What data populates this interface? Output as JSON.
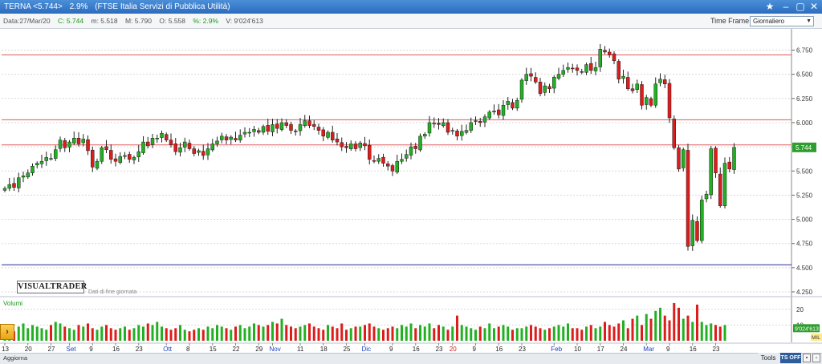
{
  "window": {
    "symbol": "TERNA <5.744>",
    "change": "2.9%",
    "description": "(FTSE Italia Servizi di Pubblica Utilità)",
    "buttons": [
      "star-icon",
      "minimize-icon",
      "restore-icon",
      "close-icon"
    ]
  },
  "infobar": {
    "date": "Data:27/Mar/20",
    "close": "C: 5.744",
    "min": "m: 5.518",
    "max": "M: 5.790",
    "open": "O: 5.558",
    "pct": "%: 2.9%",
    "volume": "V: 9'024'613"
  },
  "time_frame": {
    "label": "Time Frame",
    "selected": "Giornaliero"
  },
  "logo": "VISUALTRADER",
  "eod_note": "Dati di fine giornata",
  "volumes_label": "Volumi",
  "status": {
    "update_label": "Aggiorna",
    "tools_label": "Tools",
    "ts_label": "TS OFF"
  },
  "colors": {
    "up": "#22b022",
    "down": "#dd1c1c",
    "hline_red": "#e05a5a",
    "hline_blue": "#2a2a9a",
    "price_tag": "#2e9e2e"
  },
  "chart_data": [
    {
      "type": "candlestick",
      "last_price": "5.744",
      "y_ticks": [
        "6.750",
        "6.500",
        "6.250",
        "6.000",
        "5.750",
        "5.500",
        "5.250",
        "5.000",
        "4.750",
        "4.500",
        "4.250"
      ],
      "ylim": [
        4.25,
        6.92
      ],
      "horizontal_lines": [
        {
          "value": 6.7,
          "color": "red"
        },
        {
          "value": 6.03,
          "color": "red"
        },
        {
          "value": 5.77,
          "color": "red"
        },
        {
          "value": 4.53,
          "color": "blue"
        }
      ],
      "x_ticks": [
        {
          "label": "13",
          "index": 0,
          "month": false
        },
        {
          "label": "20",
          "index": 5,
          "month": false
        },
        {
          "label": "27",
          "index": 10,
          "month": false
        },
        {
          "label": "Set",
          "index": 14,
          "month": true
        },
        {
          "label": "9",
          "index": 19,
          "month": false
        },
        {
          "label": "16",
          "index": 24,
          "month": false
        },
        {
          "label": "23",
          "index": 29,
          "month": false
        },
        {
          "label": "Ott",
          "index": 35,
          "month": true
        },
        {
          "label": "8",
          "index": 40,
          "month": false
        },
        {
          "label": "15",
          "index": 45,
          "month": false
        },
        {
          "label": "22",
          "index": 50,
          "month": false
        },
        {
          "label": "29",
          "index": 55,
          "month": false
        },
        {
          "label": "Nov",
          "index": 58,
          "month": true
        },
        {
          "label": "11",
          "index": 64,
          "month": false
        },
        {
          "label": "18",
          "index": 69,
          "month": false
        },
        {
          "label": "25",
          "index": 74,
          "month": false
        },
        {
          "label": "Dic",
          "index": 78,
          "month": true
        },
        {
          "label": "9",
          "index": 84,
          "month": false
        },
        {
          "label": "16",
          "index": 89,
          "month": false
        },
        {
          "label": "23",
          "index": 94,
          "month": false
        },
        {
          "label": "20",
          "index": 97,
          "month": "year"
        },
        {
          "label": "9",
          "index": 102,
          "month": false
        },
        {
          "label": "16",
          "index": 107,
          "month": false
        },
        {
          "label": "23",
          "index": 112,
          "month": false
        },
        {
          "label": "Feb",
          "index": 119,
          "month": true
        },
        {
          "label": "10",
          "index": 124,
          "month": false
        },
        {
          "label": "17",
          "index": 129,
          "month": false
        },
        {
          "label": "24",
          "index": 134,
          "month": false
        },
        {
          "label": "Mar",
          "index": 139,
          "month": true
        },
        {
          "label": "9",
          "index": 144,
          "month": false
        },
        {
          "label": "16",
          "index": 149,
          "month": false
        },
        {
          "label": "23",
          "index": 154,
          "month": false
        }
      ],
      "closes": [
        5.32,
        5.36,
        5.33,
        5.43,
        5.45,
        5.48,
        5.55,
        5.58,
        5.6,
        5.64,
        5.63,
        5.72,
        5.82,
        5.74,
        5.8,
        5.84,
        5.78,
        5.83,
        5.71,
        5.54,
        5.6,
        5.74,
        5.72,
        5.62,
        5.6,
        5.65,
        5.66,
        5.62,
        5.64,
        5.7,
        5.8,
        5.76,
        5.84,
        5.84,
        5.89,
        5.82,
        5.77,
        5.7,
        5.74,
        5.8,
        5.73,
        5.68,
        5.71,
        5.66,
        5.73,
        5.78,
        5.81,
        5.86,
        5.82,
        5.85,
        5.82,
        5.87,
        5.9,
        5.9,
        5.93,
        5.9,
        5.96,
        5.91,
        5.98,
        5.94,
        6.0,
        5.97,
        5.92,
        5.91,
        5.98,
        6.02,
        5.97,
        5.96,
        5.92,
        5.86,
        5.9,
        5.82,
        5.8,
        5.75,
        5.74,
        5.78,
        5.73,
        5.79,
        5.76,
        5.62,
        5.6,
        5.63,
        5.58,
        5.55,
        5.5,
        5.6,
        5.62,
        5.67,
        5.75,
        5.73,
        5.86,
        5.88,
        6.0,
        5.99,
        5.98,
        6.0,
        5.9,
        5.92,
        5.86,
        5.91,
        5.92,
        6.0,
        6.02,
        6.0,
        6.06,
        6.11,
        6.12,
        6.08,
        6.18,
        6.22,
        6.15,
        6.23,
        6.44,
        6.5,
        6.48,
        6.42,
        6.3,
        6.38,
        6.35,
        6.47,
        6.5,
        6.54,
        6.57,
        6.56,
        6.54,
        6.52,
        6.6,
        6.54,
        6.57,
        6.76,
        6.73,
        6.7,
        6.64,
        6.45,
        6.48,
        6.35,
        6.33,
        6.4,
        6.18,
        6.26,
        6.18,
        6.4,
        6.45,
        6.4,
        6.05,
        5.74,
        5.52,
        5.72,
        4.72,
        4.99,
        4.78,
        5.2,
        5.26,
        5.73,
        5.48,
        5.14,
        5.58,
        5.52,
        5.744
      ],
      "volume_axis": {
        "ticks": [
          "20",
          "10"
        ],
        "last_label": "9'024'613",
        "unit": "MIL"
      },
      "volumes": [
        7,
        5,
        6,
        9,
        11,
        8,
        10,
        9,
        8,
        7,
        10,
        12,
        11,
        9,
        8,
        7,
        10,
        9,
        11,
        8,
        7,
        9,
        10,
        8,
        7,
        8,
        9,
        7,
        8,
        10,
        9,
        11,
        10,
        12,
        9,
        8,
        7,
        8,
        10,
        7,
        6,
        7,
        8,
        7,
        9,
        8,
        10,
        9,
        8,
        7,
        9,
        10,
        8,
        9,
        11,
        10,
        9,
        10,
        12,
        11,
        14,
        10,
        9,
        8,
        9,
        10,
        11,
        9,
        8,
        7,
        10,
        9,
        8,
        11,
        7,
        8,
        9,
        9,
        10,
        11,
        9,
        8,
        7,
        8,
        9,
        8,
        10,
        9,
        11,
        8,
        10,
        9,
        11,
        8,
        10,
        9,
        7,
        9,
        16,
        10,
        9,
        8,
        7,
        9,
        8,
        11,
        8,
        9,
        10,
        9,
        7,
        8,
        8,
        9,
        10,
        9,
        8,
        7,
        8,
        9,
        10,
        9,
        11,
        8,
        8,
        7,
        9,
        10,
        8,
        9,
        12,
        10,
        9,
        11,
        13,
        8,
        14,
        16,
        10,
        17,
        14,
        19,
        21,
        16,
        13,
        24,
        21,
        14,
        16,
        12,
        23,
        12,
        10,
        11,
        10,
        9,
        10
      ]
    }
  ]
}
